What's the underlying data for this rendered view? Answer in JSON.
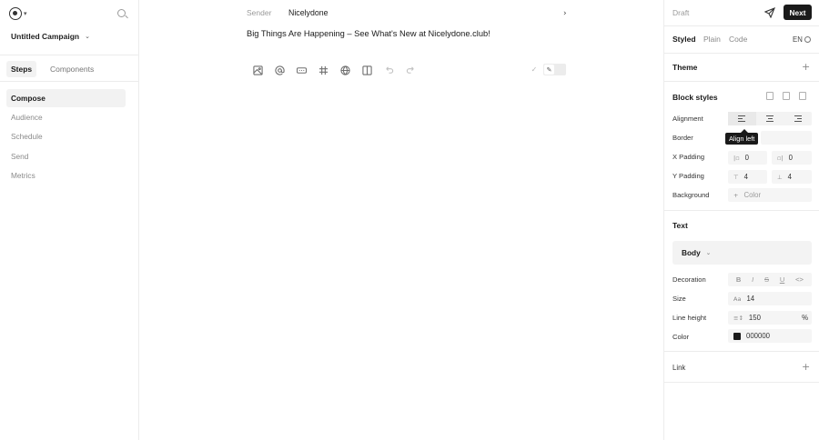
{
  "sidebar": {
    "campaign_name": "Untitled Campaign",
    "tabs": [
      "Steps",
      "Components"
    ],
    "steps": [
      "Compose",
      "Audience",
      "Schedule",
      "Send",
      "Metrics"
    ]
  },
  "editor": {
    "sender_label": "Sender",
    "sender_value": "Nicelydone",
    "subject": "Big Things Are Happening – See What's New at Nicelydone.club!",
    "toolbar_icons": [
      "image-icon",
      "mention-icon",
      "button-icon",
      "spacer-icon",
      "globe-icon",
      "columns-icon",
      "undo-icon",
      "redo-icon"
    ]
  },
  "panel": {
    "status": "Draft",
    "next_label": "Next",
    "modes": [
      "Styled",
      "Plain",
      "Code"
    ],
    "language": "EN",
    "theme_title": "Theme",
    "block_styles_title": "Block styles",
    "alignment_label": "Alignment",
    "alignment_tooltip": "Align left",
    "border_label": "Border",
    "x_padding_label": "X Padding",
    "x_padding_left": "0",
    "x_padding_right": "0",
    "y_padding_label": "Y Padding",
    "y_padding_top": "4",
    "y_padding_bottom": "4",
    "background_label": "Background",
    "background_placeholder": "Color",
    "text_title": "Text",
    "text_style": "Body",
    "decoration_label": "Decoration",
    "decoration_options": [
      "B",
      "I",
      "S",
      "U",
      "<>"
    ],
    "size_label": "Size",
    "size_value": "14",
    "line_height_label": "Line height",
    "line_height_value": "150",
    "line_height_unit": "%",
    "color_label": "Color",
    "color_value": "000000",
    "link_title": "Link"
  },
  "colors": {
    "accent": "#1a1a1a",
    "text_color_swatch": "#000000"
  }
}
